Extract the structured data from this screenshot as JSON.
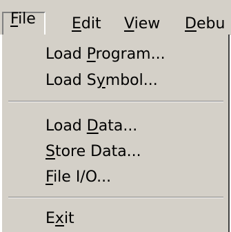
{
  "menubar": {
    "items": [
      {
        "pre": "",
        "key": "F",
        "post": "ile"
      },
      {
        "pre": "",
        "key": "E",
        "post": "dit"
      },
      {
        "pre": "",
        "key": "V",
        "post": "iew"
      },
      {
        "pre": "",
        "key": "D",
        "post": "ebu"
      }
    ]
  },
  "file_menu": {
    "items": [
      {
        "pre": "Load ",
        "key": "P",
        "post": "rogram..."
      },
      {
        "pre": "Load S",
        "key": "y",
        "post": "mbol..."
      },
      {
        "pre": "Load ",
        "key": "D",
        "post": "ata..."
      },
      {
        "pre": "",
        "key": "S",
        "post": "tore Data..."
      },
      {
        "pre": "",
        "key": "F",
        "post": "ile I/O..."
      },
      {
        "pre": "E",
        "key": "x",
        "post": "it"
      }
    ]
  },
  "colors": {
    "menu_background": "#d4d0c8",
    "text": "#000000",
    "shadow": "#808080",
    "highlight": "#ffffff"
  }
}
